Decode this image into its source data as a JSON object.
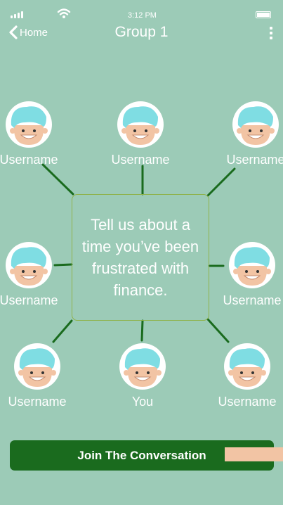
{
  "status_bar": {
    "time": "3:12 PM"
  },
  "header": {
    "back_label": "Home",
    "title": "Group 1"
  },
  "prompt": {
    "text": "Tell us about a time you’ve been frustrated with finance."
  },
  "participants": [
    {
      "label": "Username"
    },
    {
      "label": "Username"
    },
    {
      "label": "Username"
    },
    {
      "label": "Username"
    },
    {
      "label": "Username"
    },
    {
      "label": "Username"
    },
    {
      "label": "You"
    },
    {
      "label": "Username"
    }
  ],
  "action": {
    "join_label": "Join The Conversation"
  },
  "colors": {
    "background": "#9ccbb7",
    "connector": "#1a6b1e",
    "button": "#1a6b1e",
    "prompt_border": "#8fb24a",
    "hair": "#7fdde3",
    "skin": "#f2c4a4"
  }
}
